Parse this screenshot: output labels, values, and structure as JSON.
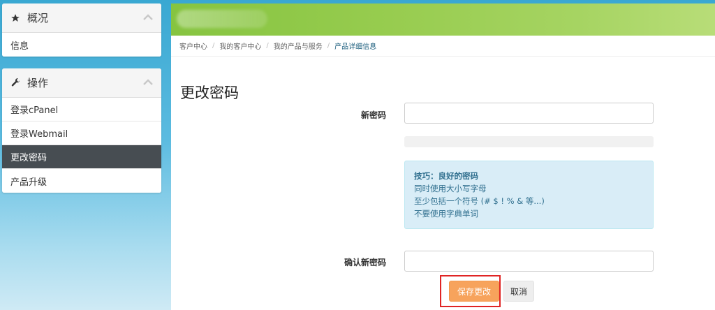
{
  "sidebar": {
    "overview": {
      "title": "概况",
      "icon": "star-icon",
      "items": [
        {
          "label": "信息"
        }
      ]
    },
    "actions": {
      "title": "操作",
      "icon": "wrench-icon",
      "items": [
        {
          "label": "登录cPanel"
        },
        {
          "label": "登录Webmail"
        },
        {
          "label": "更改密码",
          "active": true
        },
        {
          "label": "产品升级"
        }
      ]
    }
  },
  "breadcrumb": [
    "客户中心",
    "我的客户中心",
    "我的产品与服务",
    "产品详细信息"
  ],
  "page": {
    "title": "更改密码",
    "new_password_label": "新密码",
    "confirm_password_label": "确认新密码",
    "new_password_value": "",
    "confirm_password_value": ""
  },
  "tips": {
    "title": "技巧：良好的密码",
    "lines": [
      "同时使用大小写字母",
      "至少包括一个符号 (# $ ! % & 等...)",
      "不要使用字典单词"
    ]
  },
  "buttons": {
    "save": "保存更改",
    "cancel": "取消"
  },
  "colors": {
    "active_item_bg": "#474d52",
    "save_button": "#f7a35c",
    "tips_bg": "#d9edf7",
    "highlight": "#e02424"
  }
}
